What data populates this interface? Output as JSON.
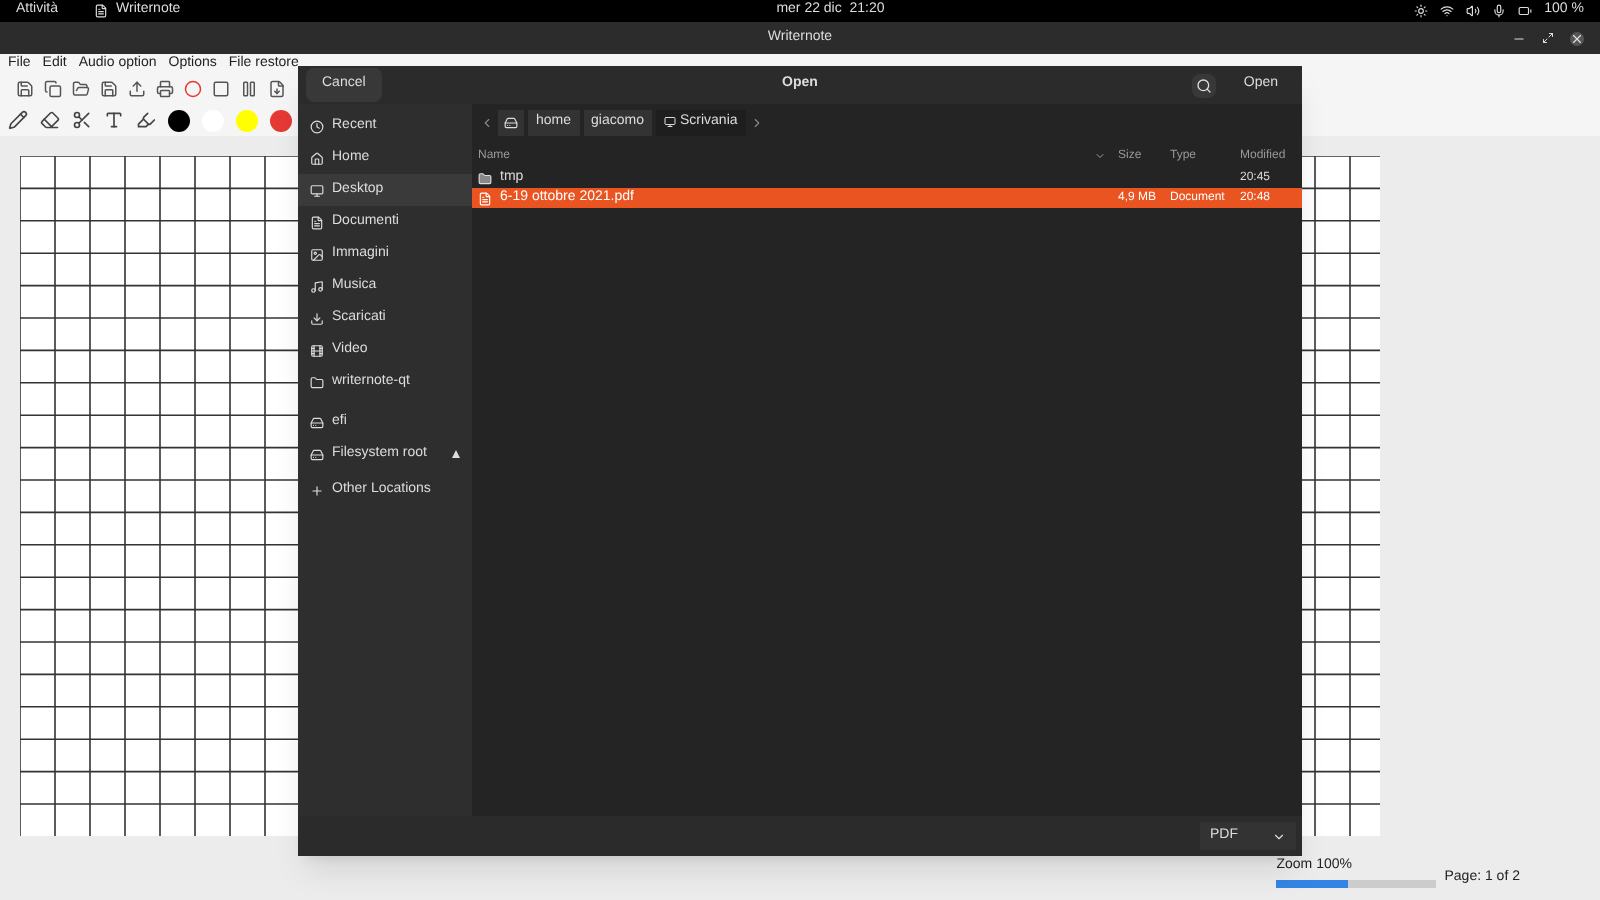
{
  "topbar": {
    "activities": "Attività",
    "app": "Writernote",
    "clock": "mer 22 dic  21:20",
    "battery": "100 %"
  },
  "window": {
    "title": "Writernote"
  },
  "menu": [
    "File",
    "Edit",
    "Audio option",
    "Options",
    "File restore"
  ],
  "colors": [
    {
      "color": "#000000"
    },
    {
      "color": "#ffffff"
    },
    {
      "color": "#ffff00"
    },
    {
      "color": "#e53935"
    }
  ],
  "dialog": {
    "cancel": "Cancel",
    "title": "Open",
    "open": "Open",
    "places": [
      {
        "kind": "recent",
        "label": "Recent",
        "selected": false
      },
      {
        "kind": "home",
        "label": "Home",
        "selected": false
      },
      {
        "kind": "desktop",
        "label": "Desktop",
        "selected": true
      },
      {
        "kind": "documents",
        "label": "Documenti",
        "selected": false
      },
      {
        "kind": "images",
        "label": "Immagini",
        "selected": false
      },
      {
        "kind": "music",
        "label": "Musica",
        "selected": false
      },
      {
        "kind": "downloads",
        "label": "Scaricati",
        "selected": false
      },
      {
        "kind": "video",
        "label": "Video",
        "selected": false
      },
      {
        "kind": "folder",
        "label": "writernote-qt",
        "selected": false
      },
      {
        "kind": "drive",
        "label": "efi",
        "selected": false
      },
      {
        "kind": "root",
        "label": "Filesystem root",
        "selected": false
      },
      {
        "kind": "other",
        "label": "Other Locations",
        "selected": false
      }
    ],
    "path": [
      {
        "label": "home",
        "selected": false
      },
      {
        "label": "giacomo",
        "selected": false
      },
      {
        "label": "Scrivania",
        "selected": true
      }
    ],
    "columns": [
      "Name",
      "Size",
      "Type",
      "Modified"
    ],
    "files": [
      {
        "kind": "folder",
        "name": "tmp",
        "modified": "20:45",
        "selected": false
      },
      {
        "kind": "pdf",
        "name": "6-19 ottobre 2021.pdf",
        "size": "4,9 MB",
        "type": "Document",
        "modified": "20:48",
        "selected": true
      }
    ],
    "filter": "PDF"
  },
  "status": {
    "zoom": "Zoom 100%",
    "level": 0.45,
    "page": "Page: 1 of 2"
  }
}
